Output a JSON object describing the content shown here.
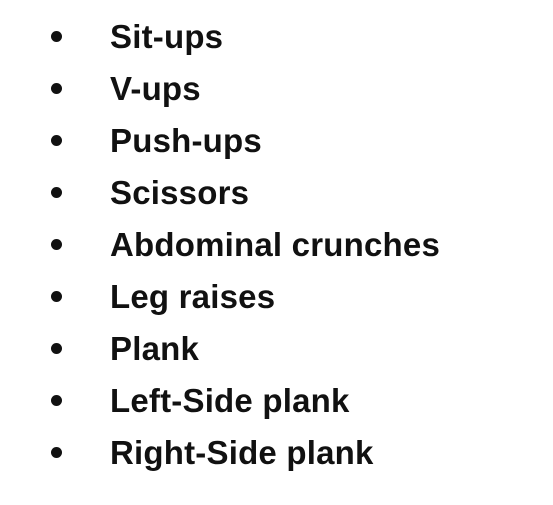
{
  "exercise_list": {
    "items": [
      {
        "label": "Sit-ups"
      },
      {
        "label": "V-ups"
      },
      {
        "label": "Push-ups"
      },
      {
        "label": "Scissors"
      },
      {
        "label": "Abdominal crunches"
      },
      {
        "label": "Leg raises"
      },
      {
        "label": "Plank"
      },
      {
        "label": "Left-Side plank"
      },
      {
        "label": "Right-Side plank"
      }
    ],
    "text_color": "#111111",
    "background_color": "#ffffff"
  }
}
